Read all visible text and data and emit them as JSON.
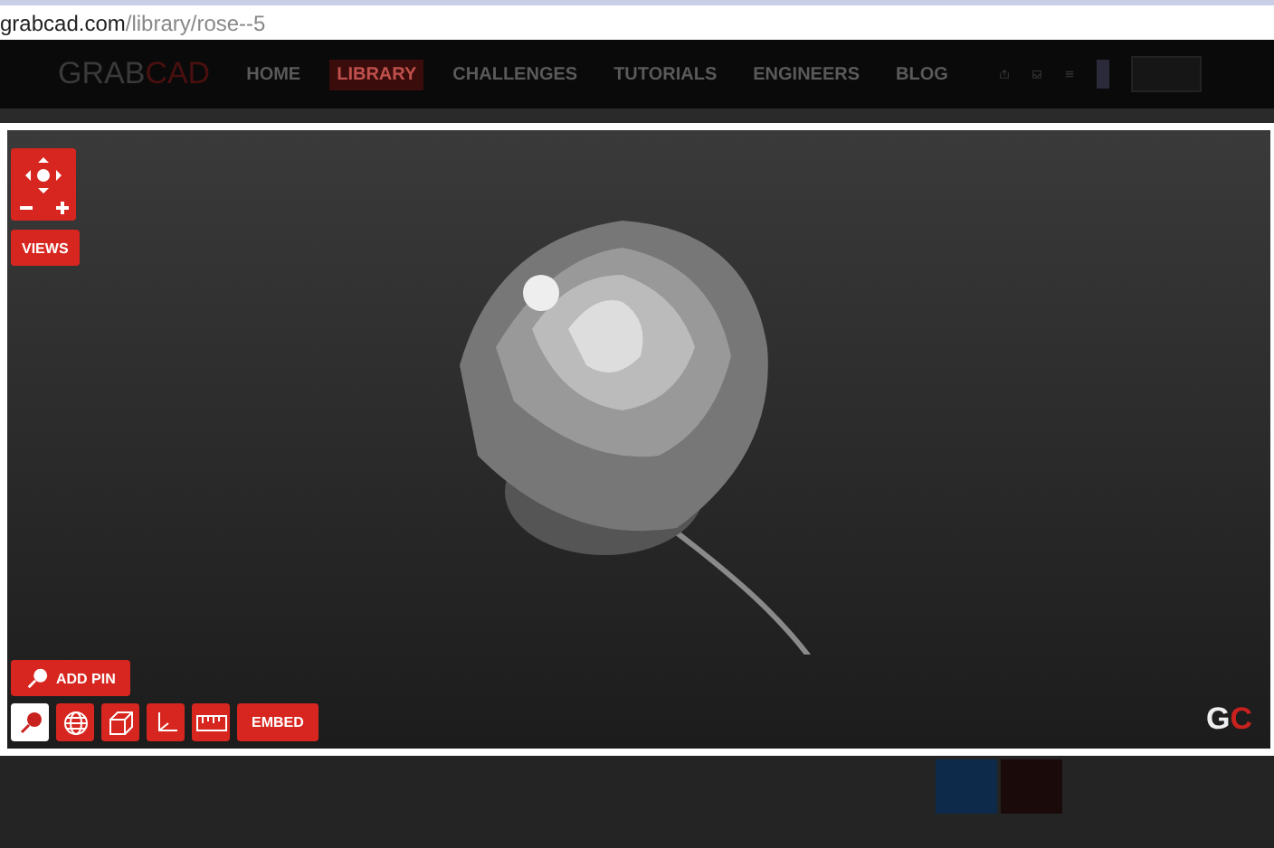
{
  "address_bar": {
    "domain": "grabcad.com",
    "path": "/library/rose--5"
  },
  "nav": {
    "logo": {
      "part_1": "GRAB",
      "part_2": "CAD"
    },
    "items": [
      {
        "label": "HOME",
        "selected": false
      },
      {
        "label": "LIBRARY",
        "selected": true
      },
      {
        "label": "CHALLENGES",
        "selected": false
      },
      {
        "label": "TUTORIALS",
        "selected": false
      },
      {
        "label": "ENGINEERS",
        "selected": false
      },
      {
        "label": "BLOG",
        "selected": false
      }
    ]
  },
  "viewer": {
    "views_label": "VIEWS",
    "add_pin_label": "ADD PIN",
    "tools": [
      {
        "kind": "pin",
        "selected": true
      },
      {
        "kind": "globe",
        "selected": false
      },
      {
        "kind": "cube",
        "selected": false
      },
      {
        "kind": "axes",
        "selected": false
      },
      {
        "kind": "ruler",
        "selected": false
      }
    ],
    "embed_label": "EMBED",
    "brand": {
      "part_1": "G",
      "part_2": "C"
    }
  }
}
